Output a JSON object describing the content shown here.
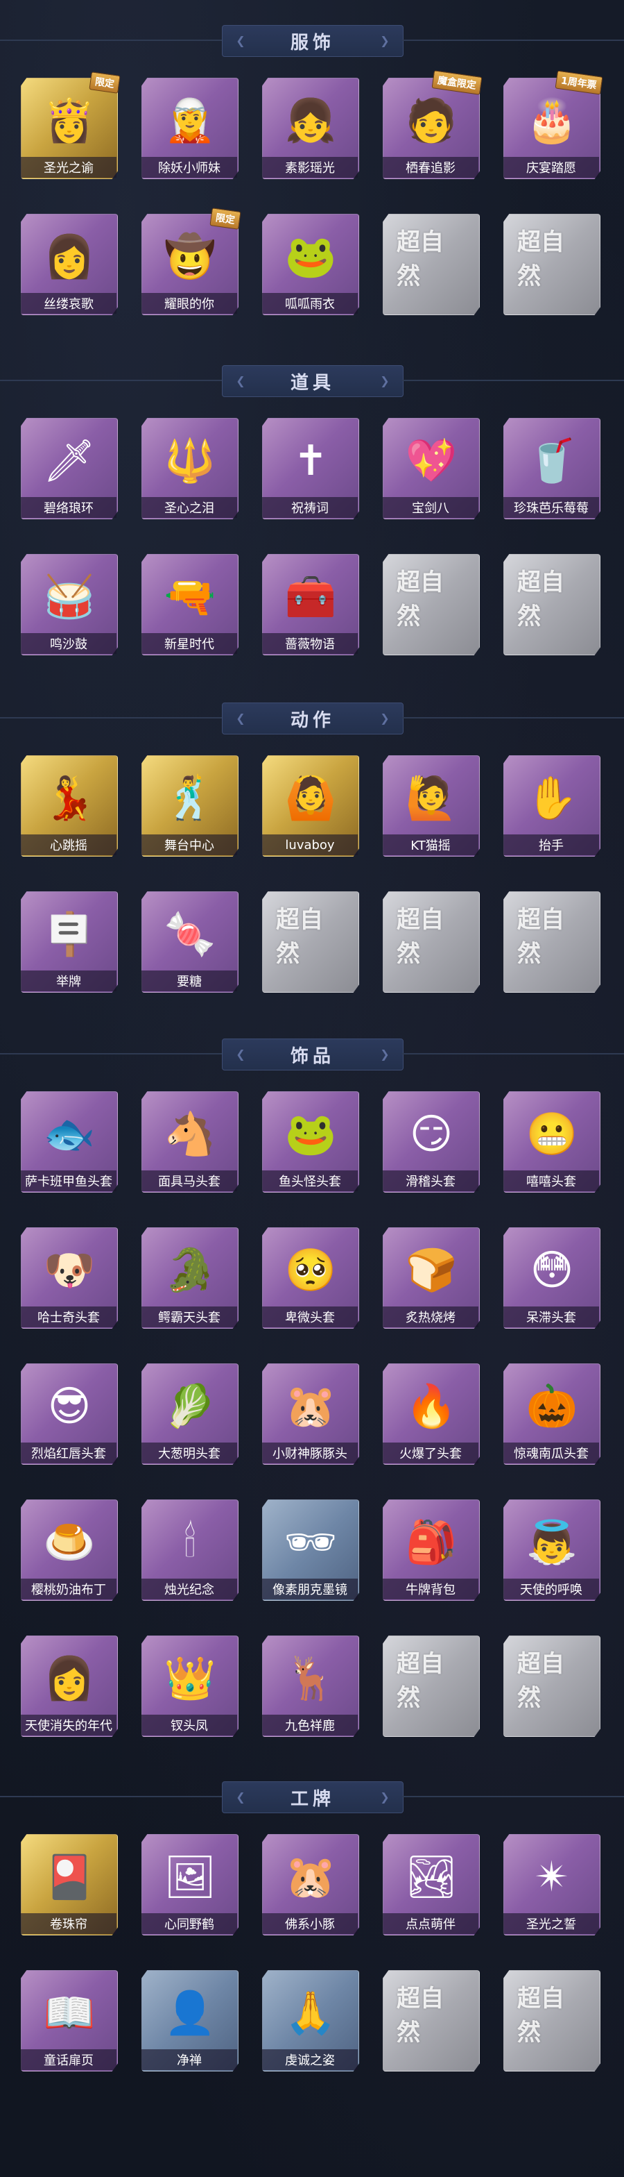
{
  "sections": [
    {
      "title": "服饰",
      "items": [
        {
          "label": "圣光之谕",
          "style": "gold",
          "icon": "portrait-icon",
          "glyph": "👸",
          "badge": "限定"
        },
        {
          "label": "除妖小师妹",
          "style": "purple",
          "icon": "portrait-icon",
          "glyph": "🧝",
          "badge": ""
        },
        {
          "label": "素影瑶光",
          "style": "purple",
          "icon": "portrait-icon",
          "glyph": "👧",
          "badge": ""
        },
        {
          "label": "栖春追影",
          "style": "purple",
          "icon": "portrait-icon",
          "glyph": "🧑",
          "badge": "魔盒限定"
        },
        {
          "label": "庆宴踏愿",
          "style": "purple",
          "icon": "portrait-icon",
          "glyph": "🎂",
          "badge": "1周年票"
        },
        {
          "label": "丝缕哀歌",
          "style": "purple",
          "icon": "portrait-icon",
          "glyph": "👩",
          "badge": ""
        },
        {
          "label": "耀眼的你",
          "style": "purple",
          "icon": "portrait-icon",
          "glyph": "🤠",
          "badge": "限定"
        },
        {
          "label": "呱呱雨衣",
          "style": "purple",
          "icon": "portrait-icon",
          "glyph": "🐸",
          "badge": ""
        },
        {
          "label": "",
          "style": "grey",
          "icon": "placeholder-logo",
          "glyph": "超自然",
          "badge": ""
        },
        {
          "label": "",
          "style": "grey",
          "icon": "placeholder-logo",
          "glyph": "超自然",
          "badge": ""
        }
      ]
    },
    {
      "title": "道具",
      "items": [
        {
          "label": "碧络琅环",
          "style": "purple",
          "icon": "sword-icon",
          "glyph": "🗡",
          "badge": ""
        },
        {
          "label": "圣心之泪",
          "style": "purple",
          "icon": "scepter-icon",
          "glyph": "🔱",
          "badge": ""
        },
        {
          "label": "祝祷词",
          "style": "purple",
          "icon": "cross-icon",
          "glyph": "✝",
          "badge": ""
        },
        {
          "label": "宝剑八",
          "style": "purple",
          "icon": "heart-icon",
          "glyph": "💖",
          "badge": ""
        },
        {
          "label": "珍珠芭乐莓莓",
          "style": "purple",
          "icon": "drink-icon",
          "glyph": "🥤",
          "badge": ""
        },
        {
          "label": "鸣沙鼓",
          "style": "purple",
          "icon": "drum-icon",
          "glyph": "🥁",
          "badge": ""
        },
        {
          "label": "新星时代",
          "style": "purple",
          "icon": "revolver-icon",
          "glyph": "🔫",
          "badge": ""
        },
        {
          "label": "蔷薇物语",
          "style": "purple",
          "icon": "case-icon",
          "glyph": "🧰",
          "badge": ""
        },
        {
          "label": "",
          "style": "grey",
          "icon": "placeholder-logo",
          "glyph": "超自然",
          "badge": ""
        },
        {
          "label": "",
          "style": "grey",
          "icon": "placeholder-logo",
          "glyph": "超自然",
          "badge": ""
        }
      ]
    },
    {
      "title": "动作",
      "items": [
        {
          "label": "心跳摇",
          "style": "gold",
          "icon": "gesture-icon",
          "glyph": "💃",
          "badge": ""
        },
        {
          "label": "舞台中心",
          "style": "gold",
          "icon": "gesture-icon",
          "glyph": "🕺",
          "badge": ""
        },
        {
          "label": "luvaboy",
          "style": "gold",
          "icon": "gesture-icon",
          "glyph": "🙆",
          "badge": ""
        },
        {
          "label": "KT猫摇",
          "style": "purple",
          "icon": "gesture-icon",
          "glyph": "🙋",
          "badge": ""
        },
        {
          "label": "抬手",
          "style": "purple",
          "icon": "gesture-icon",
          "glyph": "✋",
          "badge": ""
        },
        {
          "label": "举牌",
          "style": "purple",
          "icon": "gesture-icon",
          "glyph": "🪧",
          "badge": ""
        },
        {
          "label": "要糖",
          "style": "purple",
          "icon": "gesture-icon",
          "glyph": "🍬",
          "badge": ""
        },
        {
          "label": "",
          "style": "grey",
          "icon": "placeholder-logo",
          "glyph": "超自然",
          "badge": ""
        },
        {
          "label": "",
          "style": "grey",
          "icon": "placeholder-logo",
          "glyph": "超自然",
          "badge": ""
        },
        {
          "label": "",
          "style": "grey",
          "icon": "placeholder-logo",
          "glyph": "超自然",
          "badge": ""
        }
      ]
    },
    {
      "title": "饰品",
      "items": [
        {
          "label": "萨卡班甲鱼头套",
          "style": "purple",
          "icon": "fish-head-icon",
          "glyph": "🐟",
          "badge": ""
        },
        {
          "label": "面具马头套",
          "style": "purple",
          "icon": "horse-head-icon",
          "glyph": "🐴",
          "badge": ""
        },
        {
          "label": "鱼头怪头套",
          "style": "purple",
          "icon": "fish-monster-icon",
          "glyph": "🐸",
          "badge": ""
        },
        {
          "label": "滑稽头套",
          "style": "purple",
          "icon": "smile-icon",
          "glyph": "😏",
          "badge": ""
        },
        {
          "label": "嘻嘻头套",
          "style": "purple",
          "icon": "grin-icon",
          "glyph": "😬",
          "badge": ""
        },
        {
          "label": "哈士奇头套",
          "style": "purple",
          "icon": "dog-head-icon",
          "glyph": "🐶",
          "badge": ""
        },
        {
          "label": "鳄霸天头套",
          "style": "purple",
          "icon": "croc-head-icon",
          "glyph": "🐊",
          "badge": ""
        },
        {
          "label": "卑微头套",
          "style": "purple",
          "icon": "sad-face-icon",
          "glyph": "🥺",
          "badge": ""
        },
        {
          "label": "炙热烧烤",
          "style": "purple",
          "icon": "toast-icon",
          "glyph": "🍞",
          "badge": ""
        },
        {
          "label": "呆滞头套",
          "style": "purple",
          "icon": "blank-face-icon",
          "glyph": "😳",
          "badge": ""
        },
        {
          "label": "烈焰红唇头套",
          "style": "purple",
          "icon": "pika-head-icon",
          "glyph": "😎",
          "badge": ""
        },
        {
          "label": "大葱明头套",
          "style": "purple",
          "icon": "veggie-icon",
          "glyph": "🥬",
          "badge": ""
        },
        {
          "label": "小财神豚豚头",
          "style": "purple",
          "icon": "capybara-icon",
          "glyph": "🐹",
          "badge": ""
        },
        {
          "label": "火爆了头套",
          "style": "purple",
          "icon": "fire-icon",
          "glyph": "🔥",
          "badge": ""
        },
        {
          "label": "惊魂南瓜头套",
          "style": "purple",
          "icon": "pumpkin-icon",
          "glyph": "🎃",
          "badge": ""
        },
        {
          "label": "樱桃奶油布丁",
          "style": "purple",
          "icon": "pudding-icon",
          "glyph": "🍮",
          "badge": ""
        },
        {
          "label": "烛光纪念",
          "style": "purple",
          "icon": "candle-icon",
          "glyph": "🕯",
          "badge": ""
        },
        {
          "label": "像素朋克墨镜",
          "style": "blue",
          "icon": "sunglasses-icon",
          "glyph": "🕶",
          "badge": ""
        },
        {
          "label": "牛牌背包",
          "style": "purple",
          "icon": "backpack-icon",
          "glyph": "🎒",
          "badge": ""
        },
        {
          "label": "天使的呼唤",
          "style": "purple",
          "icon": "angel-icon",
          "glyph": "👼",
          "badge": ""
        },
        {
          "label": "天使消失的年代",
          "style": "purple",
          "icon": "portrait-icon",
          "glyph": "👩",
          "badge": ""
        },
        {
          "label": "钗头凤",
          "style": "purple",
          "icon": "headdress-icon",
          "glyph": "👑",
          "badge": ""
        },
        {
          "label": "九色祥鹿",
          "style": "purple",
          "icon": "deer-icon",
          "glyph": "🦌",
          "badge": ""
        },
        {
          "label": "",
          "style": "grey",
          "icon": "placeholder-logo",
          "glyph": "超自然",
          "badge": ""
        },
        {
          "label": "",
          "style": "grey",
          "icon": "placeholder-logo",
          "glyph": "超自然",
          "badge": ""
        }
      ]
    },
    {
      "title": "工牌",
      "items": [
        {
          "label": "卷珠帘",
          "style": "gold",
          "icon": "badge-card-icon",
          "glyph": "🎴",
          "badge": ""
        },
        {
          "label": "心同野鹤",
          "style": "purple",
          "icon": "badge-card-icon",
          "glyph": "🖼",
          "badge": ""
        },
        {
          "label": "佛系小豚",
          "style": "purple",
          "icon": "badge-card-icon",
          "glyph": "🐹",
          "badge": ""
        },
        {
          "label": "点点萌伴",
          "style": "purple",
          "icon": "badge-card-icon",
          "glyph": "🏞",
          "badge": ""
        },
        {
          "label": "圣光之誓",
          "style": "purple",
          "icon": "badge-card-icon",
          "glyph": "✴",
          "badge": ""
        },
        {
          "label": "童话扉页",
          "style": "purple",
          "icon": "badge-card-icon",
          "glyph": "📖",
          "badge": ""
        },
        {
          "label": "净禅",
          "style": "blue",
          "icon": "badge-card-icon",
          "glyph": "👤",
          "badge": ""
        },
        {
          "label": "虔诚之姿",
          "style": "blue",
          "icon": "badge-card-icon",
          "glyph": "🙏",
          "badge": ""
        },
        {
          "label": "",
          "style": "grey",
          "icon": "placeholder-logo",
          "glyph": "超自然",
          "badge": ""
        },
        {
          "label": "",
          "style": "grey",
          "icon": "placeholder-logo",
          "glyph": "超自然",
          "badge": ""
        }
      ]
    }
  ]
}
